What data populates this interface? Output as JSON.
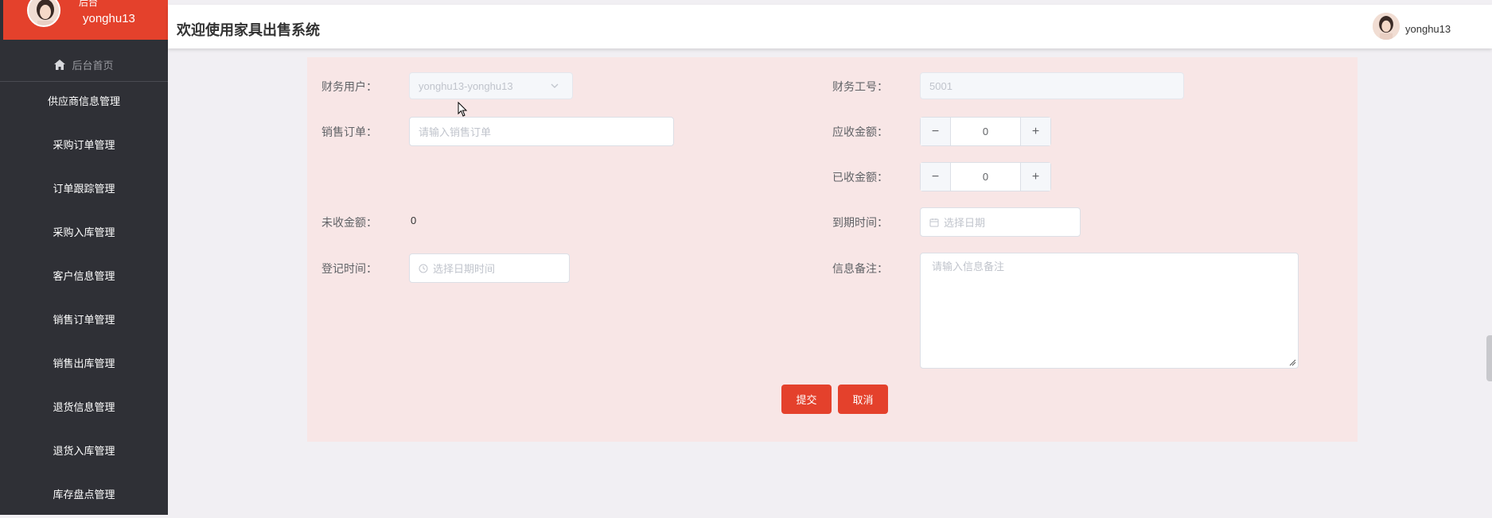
{
  "app": {
    "title": "欢迎使用家具出售系统"
  },
  "user": {
    "role": "后台",
    "name": "yonghu13"
  },
  "sidebar": {
    "home_label": "后台首页",
    "items": [
      {
        "label": "供应商信息管理"
      },
      {
        "label": "采购订单管理"
      },
      {
        "label": "订单跟踪管理"
      },
      {
        "label": "采购入库管理"
      },
      {
        "label": "客户信息管理"
      },
      {
        "label": "销售订单管理"
      },
      {
        "label": "销售出库管理"
      },
      {
        "label": "退货信息管理"
      },
      {
        "label": "退货入库管理"
      },
      {
        "label": "库存盘点管理"
      }
    ]
  },
  "form": {
    "finance_user": {
      "label": "财务用户：",
      "value": "yonghu13-yonghu13"
    },
    "finance_no": {
      "label": "财务工号：",
      "value": "5001"
    },
    "sales_order": {
      "label": "销售订单：",
      "placeholder": "请输入销售订单"
    },
    "receivable": {
      "label": "应收金额：",
      "value": "0"
    },
    "received": {
      "label": "已收金额：",
      "value": "0"
    },
    "unreceived": {
      "label": "未收金额：",
      "value": "0"
    },
    "due_date": {
      "label": "到期时间：",
      "placeholder": "选择日期"
    },
    "register_time": {
      "label": "登记时间：",
      "placeholder": "选择日期时间"
    },
    "remark": {
      "label": "信息备注：",
      "placeholder": "请输入信息备注"
    },
    "submit_label": "提交",
    "cancel_label": "取消"
  },
  "colors": {
    "accent": "#e4412c",
    "sidebar_bg": "#2f3036",
    "panel_bg": "#f8e6e6"
  }
}
